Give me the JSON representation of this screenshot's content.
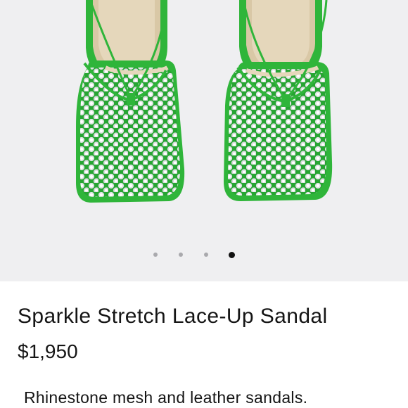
{
  "product": {
    "image_name": "green rhinestone mesh square-toe lace-up sandals",
    "title": "Sparkle Stretch Lace-Up Sandal",
    "price": "$1,950",
    "description": "Rhinestone mesh and leather sandals."
  },
  "carousel": {
    "total": 4,
    "active_index": 4
  },
  "colors": {
    "background": "#efeff1",
    "strap_green": "#2fb53a",
    "rhinestone": "#dfe3e3"
  }
}
